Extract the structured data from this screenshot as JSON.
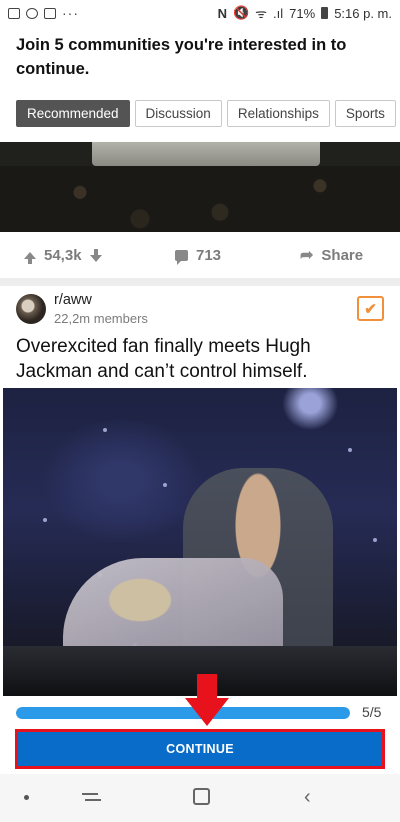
{
  "status_bar": {
    "battery": "71%",
    "time": "5:16 p. m.",
    "more": "···"
  },
  "header": {
    "title": "Join 5 communities you're interested in to continue."
  },
  "tabs": [
    {
      "label": "Recommended",
      "active": true
    },
    {
      "label": "Discussion",
      "active": false
    },
    {
      "label": "Relationships",
      "active": false
    },
    {
      "label": "Sports",
      "active": false
    }
  ],
  "previous_post": {
    "upvotes": "54,3k",
    "comments": "713",
    "share_label": "Share"
  },
  "post": {
    "community": "r/aww",
    "members": "22,2m members",
    "selected": true,
    "title": "Overexcited fan finally meets Hugh Jackman and can’t control himself."
  },
  "progress": {
    "label": "5/5",
    "fraction": 1.0
  },
  "continue_button": {
    "label": "CONTINUE"
  },
  "colors": {
    "accent": "#0a6cc9",
    "progress": "#2b9ae8",
    "check": "#f0903a",
    "annotation": "#e8121c"
  }
}
